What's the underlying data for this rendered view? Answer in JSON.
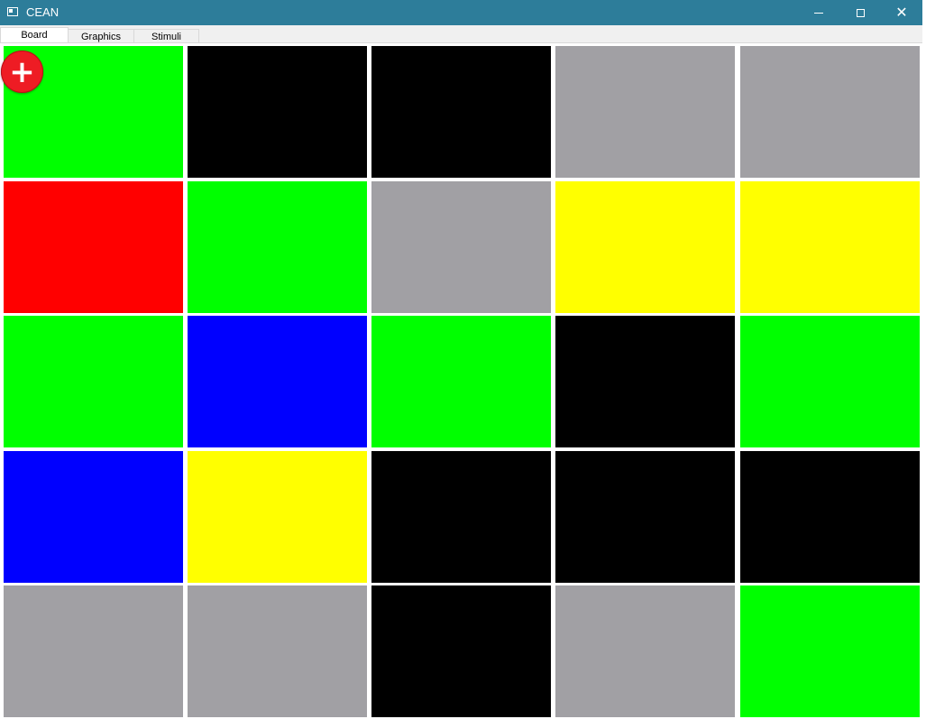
{
  "window": {
    "title": "CEAN",
    "close_glyph": "✕"
  },
  "tabs": [
    {
      "label": "Board",
      "active": true
    },
    {
      "label": "Graphics",
      "active": false
    },
    {
      "label": "Stimuli",
      "active": false
    }
  ],
  "board": {
    "rows": 5,
    "cols": 5,
    "colors": {
      "green": "#00ff00",
      "black": "#000000",
      "gray": "#a1a0a4",
      "red": "#ff0000",
      "yellow": "#ffff00",
      "blue": "#0000ff"
    },
    "grid": [
      [
        "green",
        "black",
        "black",
        "gray",
        "gray"
      ],
      [
        "red",
        "green",
        "gray",
        "yellow",
        "yellow"
      ],
      [
        "green",
        "blue",
        "green",
        "black",
        "green"
      ],
      [
        "blue",
        "yellow",
        "black",
        "black",
        "black"
      ],
      [
        "gray",
        "gray",
        "black",
        "gray",
        "green"
      ]
    ]
  },
  "add_button": {
    "glyph": "+",
    "icon": "plus-icon",
    "color": "#ee1c24"
  },
  "colors": {
    "titlebar": "#2d7d9a",
    "tab_active": "#ffffff",
    "tab_inactive": "#f0f0f0"
  }
}
